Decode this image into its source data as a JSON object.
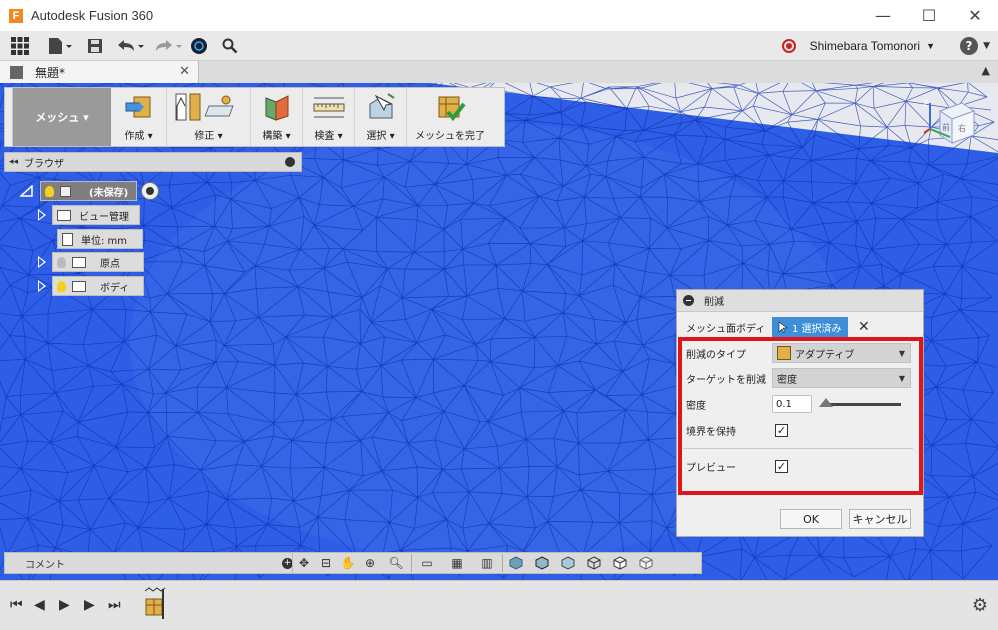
{
  "window": {
    "title": "Autodesk Fusion 360",
    "app_letter": "F",
    "minimize": "—",
    "maximize": "☐",
    "close": "✕"
  },
  "toolbar": {
    "user_name": "Shimebara Tomonori",
    "user_caret": "▼",
    "help_label": "?"
  },
  "tab": {
    "document_name": "無題*",
    "close": "✕",
    "collapse": "▲"
  },
  "ribbon": {
    "workspace": "メッシュ ▾",
    "groups": [
      {
        "label": "作成 ▾",
        "icon": "create-icon"
      },
      {
        "label": "修正 ▾",
        "icon": "modify-icon"
      },
      {
        "label": "構築 ▾",
        "icon": "construct-icon"
      },
      {
        "label": "検査 ▾",
        "icon": "inspect-icon"
      },
      {
        "label": "選択 ▾",
        "icon": "select-icon"
      },
      {
        "label": "メッシュを完了",
        "icon": "finish-mesh-icon"
      }
    ]
  },
  "browser": {
    "title": "ブラウザ",
    "collapse_arrows": "◂◂",
    "root_label": "(未保存)",
    "items": [
      {
        "label": "ビュー管理",
        "has_bulb": false
      },
      {
        "label": "単位: mm",
        "has_bulb": false
      },
      {
        "label": "原点",
        "has_bulb": true,
        "bulb_color": "#bbbbbb"
      },
      {
        "label": "ボディ",
        "has_bulb": true,
        "bulb_color": "#f2d21b"
      }
    ]
  },
  "navcube": {
    "axis_z": "Z",
    "face_left": "前",
    "face_right": "右"
  },
  "dialog": {
    "title": "削減",
    "mesh_body_label": "メッシュ面ボディ",
    "selection_button": "1 選択済み",
    "clear": "✕",
    "type_label": "削減のタイプ",
    "type_value": "アダプティブ",
    "target_label": "ターゲットを削減",
    "target_value": "密度",
    "density_label": "密度",
    "density_value": "0.1",
    "density_slider": 0.0,
    "preserve_label": "境界を保持",
    "preserve_checked": true,
    "preview_label": "プレビュー",
    "preview_checked": true,
    "ok": "OK",
    "cancel": "キャンセル",
    "check_glyph": "✓",
    "caret": "▼",
    "highlight_color": "#e0141c"
  },
  "bottom": {
    "comment_label": "コメント",
    "plus": "+"
  },
  "colors": {
    "mesh_fill": "#2e5ee6",
    "mesh_line": "#0e2fb0",
    "accent": "#3d8fd9"
  }
}
